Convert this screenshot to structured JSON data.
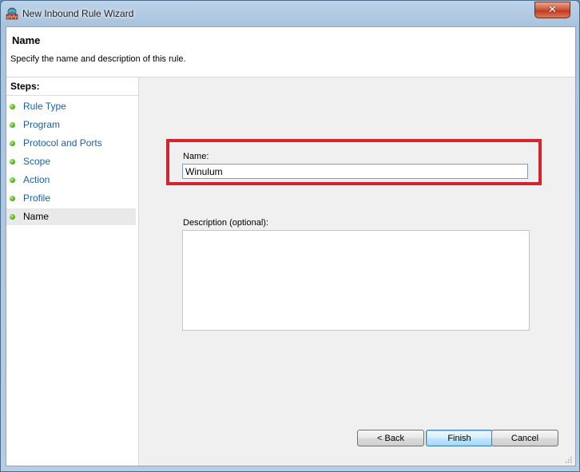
{
  "window": {
    "title": "New Inbound Rule Wizard",
    "close_glyph": "✕",
    "icon": "firewall-wall-icon"
  },
  "header": {
    "title": "Name",
    "subtitle": "Specify the name and description of this rule."
  },
  "steps": {
    "title": "Steps:",
    "items": [
      {
        "label": "Rule Type"
      },
      {
        "label": "Program"
      },
      {
        "label": "Protocol and Ports"
      },
      {
        "label": "Scope"
      },
      {
        "label": "Action"
      },
      {
        "label": "Profile"
      },
      {
        "label": "Name"
      }
    ],
    "active": "Name"
  },
  "form": {
    "name_label": "Name:",
    "name_value": "Winulum",
    "description_label": "Description (optional):",
    "description_value": ""
  },
  "buttons": {
    "back": "< Back",
    "finish": "Finish",
    "cancel": "Cancel"
  },
  "colors": {
    "highlight": "#d4252e",
    "step_link": "#1c5f9e",
    "step_dot": "#4aa11c"
  }
}
